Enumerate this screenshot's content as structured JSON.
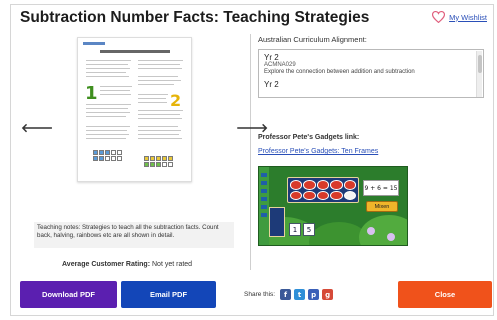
{
  "header": {
    "title": "Subtraction Number Facts: Teaching Strategies",
    "wishlist_label": "My Wishlist"
  },
  "preview": {
    "notes": "Teaching notes: Strategies to teach all the subtraction facts. Count back, halving, rainbows etc are all shown in detail.",
    "rating_label": "Average Customer Rating:",
    "rating_value": "Not yet rated"
  },
  "curriculum": {
    "label": "Australian Curriculum Alignment:",
    "items": [
      {
        "year": "Yr 2",
        "code": "ACMNA029",
        "description": "Explore the connection between addition and subtraction"
      },
      {
        "year": "Yr 2"
      }
    ]
  },
  "gadgets": {
    "label": "Professor Pete's Gadgets link:",
    "link_text": "Professor Pete's Gadgets: Ten Frames",
    "equation": "9 + 6 = 15",
    "button_label": "Mixen",
    "tiles": [
      "1",
      "5"
    ]
  },
  "footer": {
    "download_label": "Download PDF",
    "email_label": "Email PDF",
    "share_label": "Share this:",
    "close_label": "Close"
  },
  "colors": {
    "download": "#5b1fb0",
    "email": "#1346b8",
    "close": "#f0521b",
    "link": "#2a4fb8",
    "wishlist_heart": "#e0607e"
  }
}
